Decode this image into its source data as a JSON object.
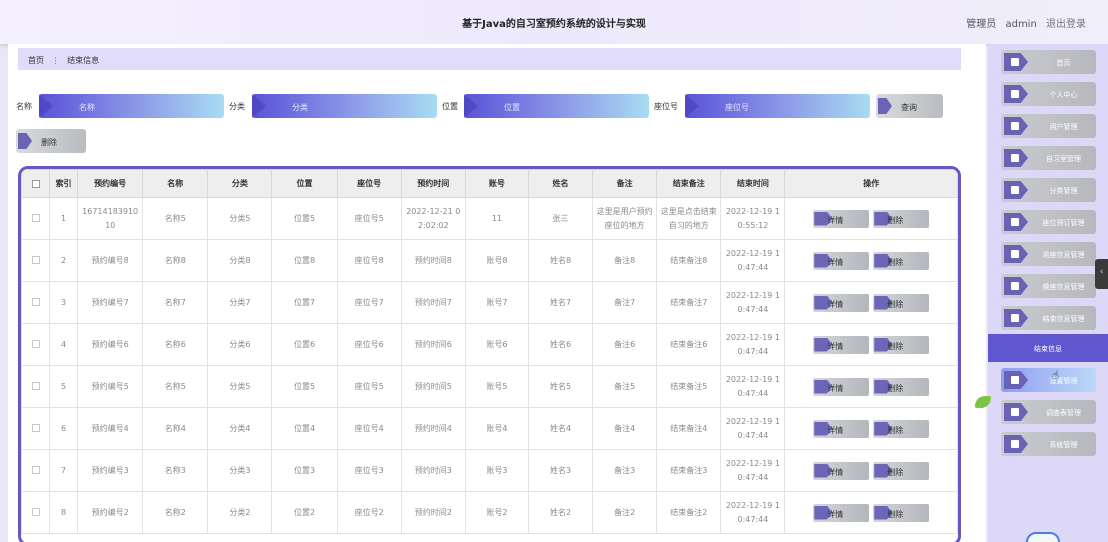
{
  "header": {
    "title": "基于Java的自习室预约系统的设计与实现",
    "role": "管理员",
    "user": "admin",
    "logout": "退出登录"
  },
  "breadcrumb": {
    "home": "首页",
    "sep": "⋮",
    "current": "结束信息"
  },
  "search": {
    "fields": [
      {
        "label": "名称",
        "placeholder": "名称"
      },
      {
        "label": "分类",
        "placeholder": "分类"
      },
      {
        "label": "位置",
        "placeholder": "位置"
      },
      {
        "label": "座位号",
        "placeholder": "座位号"
      }
    ],
    "query_button": "查询",
    "delete_button": "删除"
  },
  "table": {
    "headers": [
      "",
      "索引",
      "预约编号",
      "名称",
      "分类",
      "位置",
      "座位号",
      "预约时间",
      "账号",
      "姓名",
      "备注",
      "结束备注",
      "结束时间",
      "操作"
    ],
    "detail_label": "详情",
    "delete_label": "删除",
    "rows": [
      {
        "idx": "1",
        "no": "1671418391010",
        "name": "名称5",
        "cat": "分类5",
        "pos": "位置5",
        "seat": "座位号5",
        "time": "2022-12-21 02:02:02",
        "acct": "11",
        "person": "张三",
        "note": "这里是用户预约座位的地方",
        "endnote": "这里是点击结束自习的地方",
        "endtime": "2022-12-19 10:55:12"
      },
      {
        "idx": "2",
        "no": "预约编号8",
        "name": "名称8",
        "cat": "分类8",
        "pos": "位置8",
        "seat": "座位号8",
        "time": "预约时间8",
        "acct": "账号8",
        "person": "姓名8",
        "note": "备注8",
        "endnote": "结束备注8",
        "endtime": "2022-12-19 10:47:44"
      },
      {
        "idx": "3",
        "no": "预约编号7",
        "name": "名称7",
        "cat": "分类7",
        "pos": "位置7",
        "seat": "座位号7",
        "time": "预约时间7",
        "acct": "账号7",
        "person": "姓名7",
        "note": "备注7",
        "endnote": "结束备注7",
        "endtime": "2022-12-19 10:47:44"
      },
      {
        "idx": "4",
        "no": "预约编号6",
        "name": "名称6",
        "cat": "分类6",
        "pos": "位置6",
        "seat": "座位号6",
        "time": "预约时间6",
        "acct": "账号6",
        "person": "姓名6",
        "note": "备注6",
        "endnote": "结束备注6",
        "endtime": "2022-12-19 10:47:44"
      },
      {
        "idx": "5",
        "no": "预约编号5",
        "name": "名称5",
        "cat": "分类5",
        "pos": "位置5",
        "seat": "座位号5",
        "time": "预约时间5",
        "acct": "账号5",
        "person": "姓名5",
        "note": "备注5",
        "endnote": "结束备注5",
        "endtime": "2022-12-19 10:47:44"
      },
      {
        "idx": "6",
        "no": "预约编号4",
        "name": "名称4",
        "cat": "分类4",
        "pos": "位置4",
        "seat": "座位号4",
        "time": "预约时间4",
        "acct": "账号4",
        "person": "姓名4",
        "note": "备注4",
        "endnote": "结束备注4",
        "endtime": "2022-12-19 10:47:44"
      },
      {
        "idx": "7",
        "no": "预约编号3",
        "name": "名称3",
        "cat": "分类3",
        "pos": "位置3",
        "seat": "座位号3",
        "time": "预约时间3",
        "acct": "账号3",
        "person": "姓名3",
        "note": "备注3",
        "endnote": "结束备注3",
        "endtime": "2022-12-19 10:47:44"
      },
      {
        "idx": "8",
        "no": "预约编号2",
        "name": "名称2",
        "cat": "分类2",
        "pos": "位置2",
        "seat": "座位号2",
        "time": "预约时间2",
        "acct": "账号2",
        "person": "姓名2",
        "note": "备注2",
        "endnote": "结束备注2",
        "endtime": "2022-12-19 10:47:44"
      }
    ]
  },
  "sidebar": {
    "items": [
      {
        "label": "首页",
        "icon": "home-icon"
      },
      {
        "label": "个人中心",
        "icon": "user-icon"
      },
      {
        "label": "用户管理",
        "icon": "users-icon"
      },
      {
        "label": "自习室管理",
        "icon": "grid-icon"
      },
      {
        "label": "分类管理",
        "icon": "grid-icon"
      },
      {
        "label": "座位预订管理",
        "icon": "document-icon"
      },
      {
        "label": "退座信息管理",
        "icon": "document-icon"
      },
      {
        "label": "换座信息管理",
        "icon": "ticket-icon"
      },
      {
        "label": "结束信息管理",
        "icon": "document-icon"
      },
      {
        "label": "结束信息",
        "icon": ""
      },
      {
        "label": "设置管理",
        "icon": "settings-icon"
      },
      {
        "label": "调查表管理",
        "icon": "grid-icon"
      },
      {
        "label": "系统管理",
        "icon": "document-icon"
      }
    ],
    "collapse_glyph": "‹"
  },
  "colors": {
    "accent": "#5f57cd",
    "border": "#6459c4",
    "breadcrumb_bg": "#e1dcfa"
  }
}
